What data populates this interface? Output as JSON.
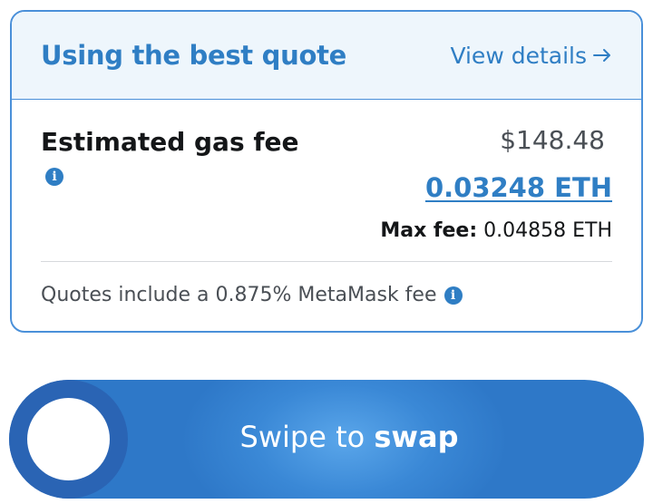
{
  "quote_header": {
    "title": "Using the best quote",
    "view_details_label": "View details",
    "arrow_icon": "arrow-right-icon"
  },
  "gas_fee": {
    "label": "Estimated gas fee",
    "usd_value": "$148.48",
    "eth_value": "0.03248 ETH",
    "max_fee_label": "Max fee:",
    "max_fee_value": "0.04858 ETH",
    "info_icon": "info-icon"
  },
  "quote_note": {
    "text": "Quotes include a 0.875% MetaMask fee",
    "info_icon": "info-icon"
  },
  "swipe_button": {
    "prefix": "Swipe to ",
    "action": "swap"
  },
  "colors": {
    "accent": "#2f7ec4",
    "header_bg": "#eef6fc",
    "swipe_bg": "#3a88d6",
    "swipe_handle": "#2a64b4"
  }
}
